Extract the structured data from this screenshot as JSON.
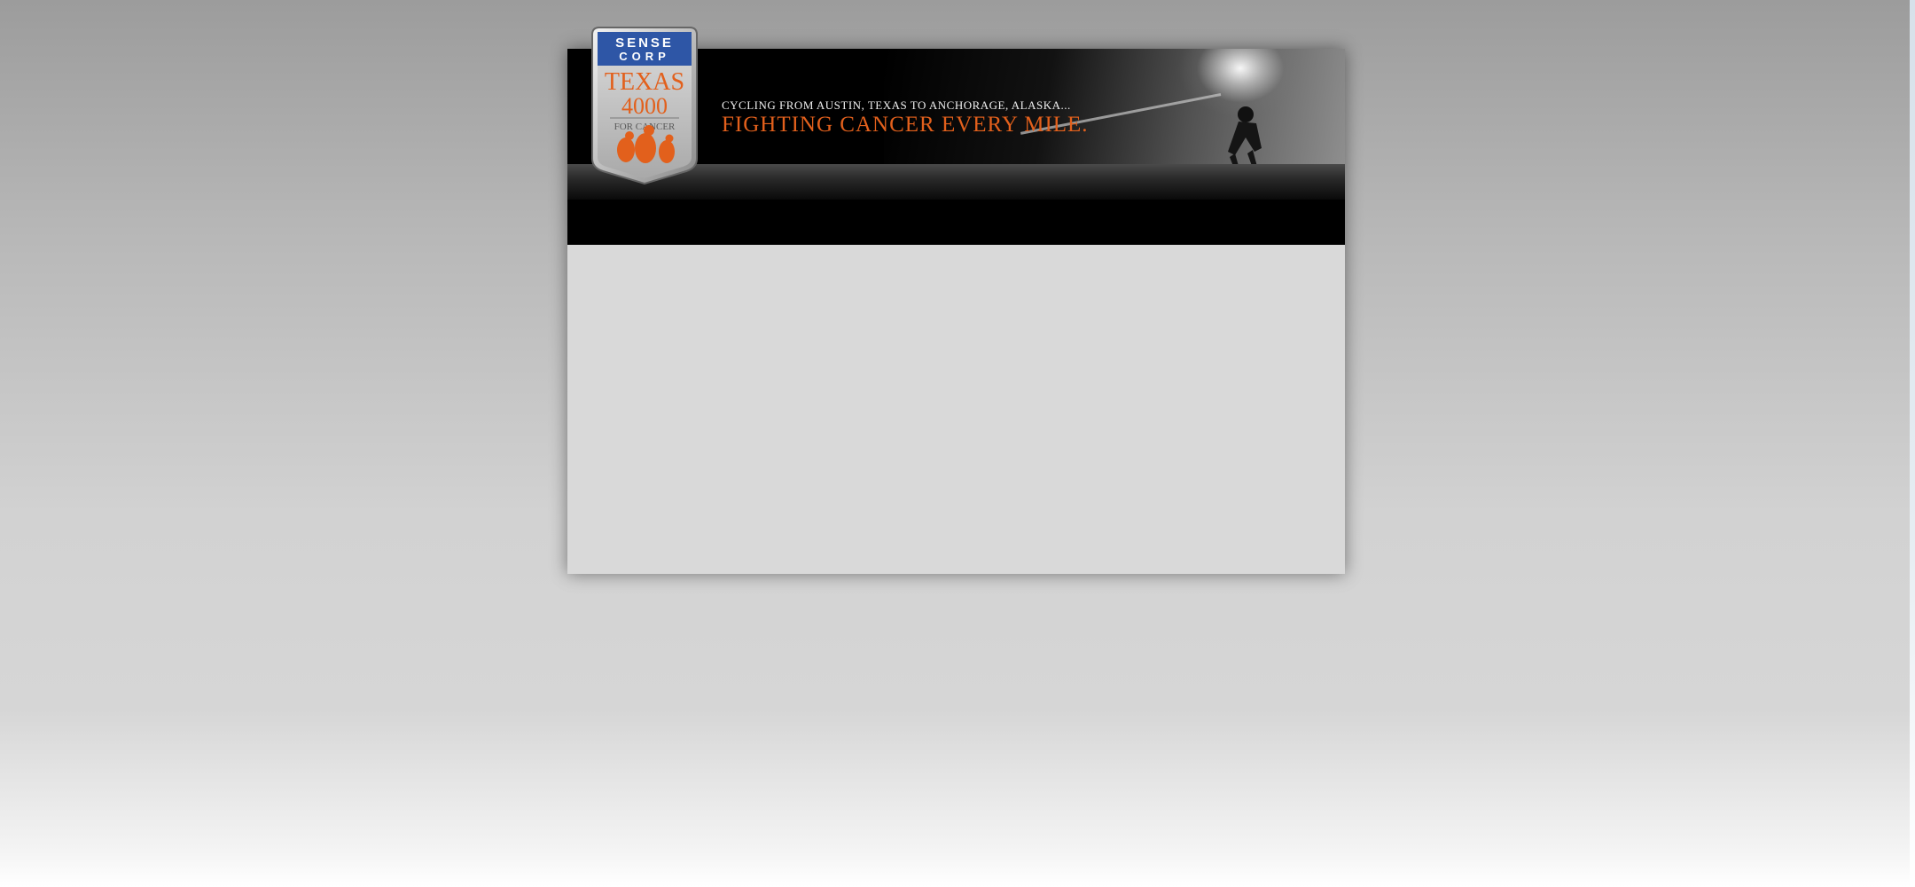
{
  "logo": {
    "top_line_1": "SENSE",
    "top_line_2": "CORP",
    "title": "TEXAS",
    "number": "4000",
    "subtitle": "FOR CANCER",
    "colors": {
      "blue": "#2e56a6",
      "orange": "#e2601c",
      "silver": "#c8c8c8"
    }
  },
  "header": {
    "tagline_top": "CYCLING FROM AUSTIN, TEXAS TO ANCHORAGE, ALASKA...",
    "tagline_main": "FIGHTING CANCER EVERY MILE.",
    "accent_color": "#e2601c"
  },
  "main": {
    "content": ""
  }
}
